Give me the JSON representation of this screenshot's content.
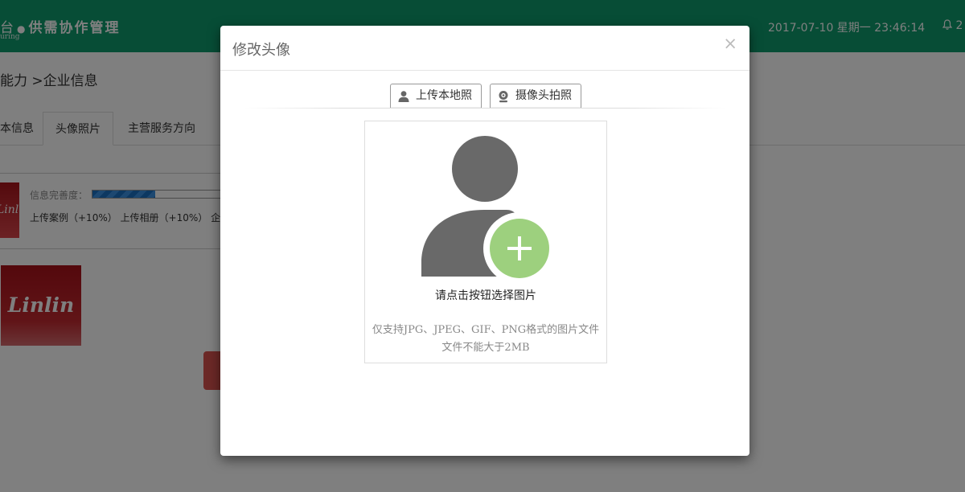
{
  "header": {
    "brand_prefix": "台",
    "brand_separator": "●",
    "brand_title": "供需协作管理",
    "brand_subtitle": "uring",
    "datetime": "2017-07-10 星期一 23:46:14",
    "bell_count": "2"
  },
  "breadcrumb": "能力 >企业信息",
  "tabs": [
    {
      "label": "本信息",
      "active": false
    },
    {
      "label": "头像照片",
      "active": true
    },
    {
      "label": "主营服务方向",
      "active": false
    }
  ],
  "profile": {
    "completeness_label": "信息完善度：",
    "completeness_fraction": 0.45,
    "upload_tips": "上传案例（+10%） 上传相册（+10%） 企业",
    "logo_text": "Linlin"
  },
  "modal": {
    "title": "修改头像",
    "close": "×",
    "mode_tabs": [
      {
        "label": "上传本地照",
        "icon": "user-icon",
        "active": true
      },
      {
        "label": "摄像头拍照",
        "icon": "camera-icon",
        "active": false
      }
    ],
    "prompt": "请点击按钮选择图片",
    "note_line1": "仅支持JPG、JPEG、GIF、PNG格式的图片文件",
    "note_line2": "文件不能大于2MB"
  },
  "colors": {
    "topbar": "#0e9a6c",
    "accent_green": "#9dd07e",
    "avatar_gray": "#696969",
    "progress_blue": "#1a70c2"
  }
}
